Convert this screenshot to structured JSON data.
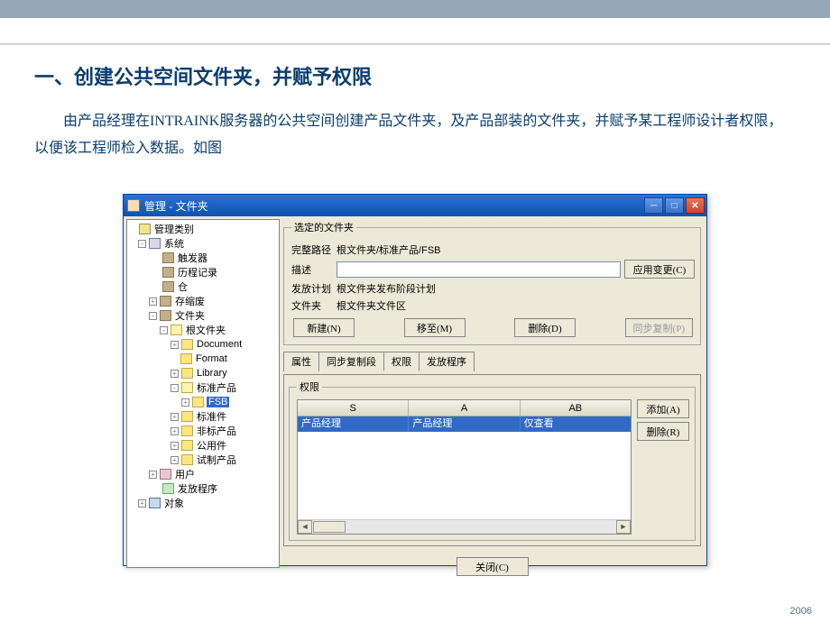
{
  "top_bar": true,
  "slide_title": "一、创建公共空间文件夹，并赋予权限",
  "body_text": "由产品经理在INTRAINK服务器的公共空间创建产品文件夹，及产品部装的文件夹，并赋予某工程师设计者权限，以便该工程师检入数据。如图",
  "footer_year": "2006",
  "window": {
    "title": "管理 - 文件夹"
  },
  "tree": {
    "root": "管理类别",
    "system": "系统",
    "items": {
      "trigger": "触发器",
      "history": "历程记录",
      "store": "仓",
      "cache": "存缩废",
      "folder": "文件夹",
      "root_folder": "根文件夹",
      "document": "Document",
      "format": "Format",
      "library": "Library",
      "std_product": "标准产品",
      "fsb": "FSB",
      "std_part": "标准件",
      "non_std": "非标产品",
      "common": "公用件",
      "custom": "试制产品",
      "user": "用户",
      "release": "发放程序",
      "object": "对象"
    }
  },
  "form": {
    "group_label": "选定的文件夹",
    "path_label": "完整路径",
    "path_value": "根文件夹/标准产品/FSB",
    "desc_label": "描述",
    "desc_value": "",
    "plan_label": "发放计划",
    "plan_value": "根文件夹发布阶段计划",
    "area_label": "文件夹",
    "area_value": "根文件夹文件区",
    "btn_apply": "应用变更(C)",
    "btn_new": "新建(N)",
    "btn_move": "移至(M)",
    "btn_delete": "删除(D)",
    "btn_sync_copy": "同步复制(P)"
  },
  "tabs": {
    "attr": "属性",
    "sync": "同步复制段",
    "perm": "权限",
    "release": "发放程序"
  },
  "perm": {
    "group_label": "权限",
    "cols": {
      "s": "S",
      "a": "A",
      "ab": "AB"
    },
    "row": {
      "s": "产品经理",
      "a": "产品经理",
      "ab": "仅查看"
    },
    "btn_add": "添加(A)",
    "btn_del": "删除(R)"
  },
  "close_btn": "关闭(C)"
}
